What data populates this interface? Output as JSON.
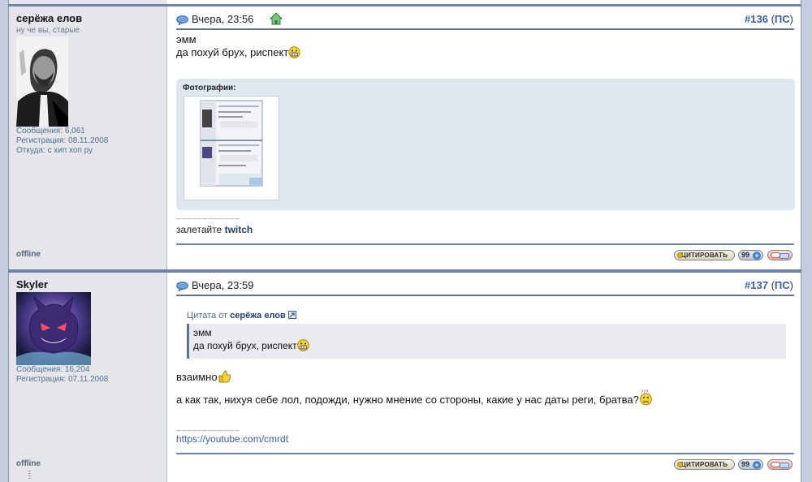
{
  "posts": [
    {
      "author": {
        "name": "серёжа елов",
        "title": "ну че вы, старые"
      },
      "stats": {
        "messages": "Сообщения: 6,061",
        "registration": "Регистрация: 08.11.2008",
        "location": "Откуда: с хип хоп ру"
      },
      "status": "offline",
      "date": "Вчера, 23:56",
      "number": "#136",
      "ps_label": "ПС",
      "body_lines": [
        "эмм",
        "да похуй брух, риспект"
      ],
      "photos_label": "Фотографии:",
      "signature_separator": "____________",
      "signature_prefix": "залетайте",
      "signature_link": "twitch"
    },
    {
      "author": {
        "name": "Skyler"
      },
      "stats": {
        "messages": "Сообщения: 16,204",
        "registration": "Регистрация: 07.11.2008"
      },
      "status": "offline",
      "date": "Вчера, 23:59",
      "number": "#137",
      "ps_label": "ПС",
      "quote": {
        "header_prefix": "Цитата от",
        "author": "серёжа елов",
        "lines": [
          "эмм",
          "да похуй брух, риспект"
        ]
      },
      "body_lines": [
        "взаимно",
        "а как так, нихуя себе лол, подожди, нужно мнение со стороны, какие у нас даты реги, братва?"
      ],
      "signature_separator": "____________",
      "signature_link": "https://youtube.com/cmrdt"
    }
  ],
  "buttons": {
    "quote_label": "ЦИТИРОВАТЬ",
    "multiquote_label": "99",
    "multiquote_plus": "+"
  },
  "colors": {
    "page_bg": "#c3cddb",
    "separator": "#6f82a8",
    "link": "#3a5fa4",
    "sidebar_bg": "#e4e6ea"
  }
}
